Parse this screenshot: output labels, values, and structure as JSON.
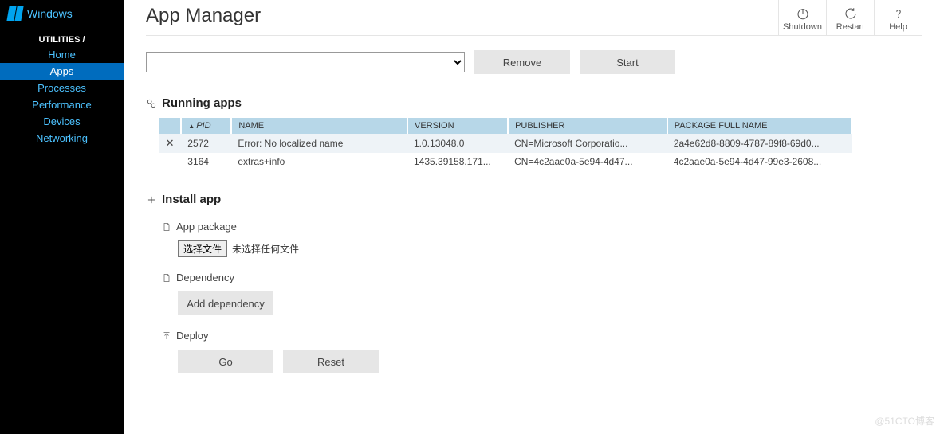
{
  "sidebar": {
    "brand": "Windows",
    "crumb": "UTILITIES /",
    "items": [
      "Home",
      "Apps",
      "Processes",
      "Performance",
      "Devices",
      "Networking"
    ],
    "active": 1
  },
  "header": {
    "title": "App Manager",
    "actions": {
      "shutdown": "Shutdown",
      "restart": "Restart",
      "help": "Help"
    }
  },
  "toolbar": {
    "remove": "Remove",
    "start": "Start"
  },
  "running": {
    "heading": "Running apps",
    "columns": {
      "pid": "PID",
      "name": "NAME",
      "version": "VERSION",
      "publisher": "PUBLISHER",
      "pkg": "PACKAGE FULL NAME"
    },
    "rows": [
      {
        "close": "✕",
        "pid": "2572",
        "name": "Error: No localized name",
        "version": "1.0.13048.0",
        "publisher": "CN=Microsoft Corporatio...",
        "pkg": "2a4e62d8-8809-4787-89f8-69d0..."
      },
      {
        "close": "",
        "pid": "3164",
        "name": "extras+info",
        "version": "1435.39158.171...",
        "publisher": "CN=4c2aae0a-5e94-4d47...",
        "pkg": "4c2aae0a-5e94-4d47-99e3-2608..."
      }
    ]
  },
  "install": {
    "heading": "Install app",
    "package": "App package",
    "choose": "选择文件",
    "nofile": "未选择任何文件",
    "dependency": "Dependency",
    "add_dep": "Add dependency",
    "deploy": "Deploy",
    "go": "Go",
    "reset": "Reset"
  },
  "watermark": "@51CTO博客"
}
